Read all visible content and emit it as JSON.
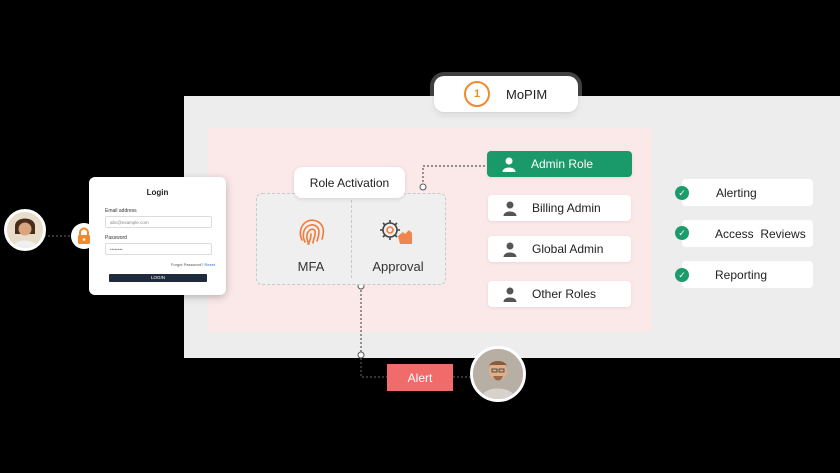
{
  "app": {
    "name": "MoPIM"
  },
  "role_activation": {
    "title": "Role Activation"
  },
  "methods": [
    {
      "label": "MFA",
      "icon": "fingerprint-icon"
    },
    {
      "label": "Approval",
      "icon": "gear-approval-icon"
    }
  ],
  "roles": [
    {
      "label": "Admin Role",
      "active": true
    },
    {
      "label": "Billing Admin",
      "active": false
    },
    {
      "label": "Global Admin",
      "active": false
    },
    {
      "label": "Other Roles",
      "active": false
    }
  ],
  "features": [
    {
      "label": "Alerting"
    },
    {
      "label": "Access  Reviews"
    },
    {
      "label": "Reporting"
    }
  ],
  "login": {
    "title": "Login",
    "email_label": "Email address",
    "email_placeholder": "abc@example.com",
    "password_label": "Password",
    "password_placeholder": "••••••••",
    "forgot_text": "Forgot Password?",
    "reset_link": "Reset",
    "button_label": "LOGIN"
  },
  "alert": {
    "label": "Alert"
  },
  "colors": {
    "accent_green": "#1a9a6a",
    "alert_red": "#f26b6b",
    "brand_orange": "#f08a2c"
  }
}
